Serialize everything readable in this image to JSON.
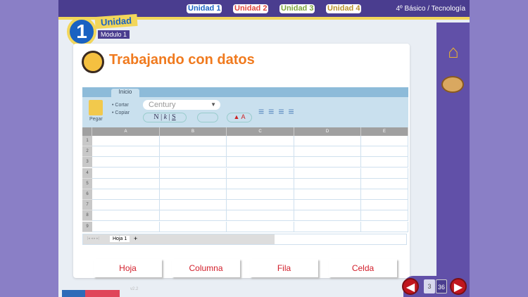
{
  "header": {
    "units": [
      {
        "label": "Unidad 1",
        "color": "#1a62c2"
      },
      {
        "label": "Unidad 2",
        "color": "#e0463c"
      },
      {
        "label": "Unidad 3",
        "color": "#7aa63a"
      },
      {
        "label": "Unidad 4",
        "color": "#b8902a"
      }
    ],
    "grade": "4º Básico / Tecnología"
  },
  "badge": {
    "number": "1",
    "unit": "Unidad",
    "module": "Módulo 1"
  },
  "title": "Trabajando con datos",
  "spreadsheet": {
    "tab": "Inicio",
    "paste": "Pegar",
    "cut": "Cortar",
    "copy": "Copiar",
    "font": "Century",
    "bold": "N",
    "italic": "k",
    "underline": "S",
    "columns": [
      "A",
      "B",
      "C",
      "D",
      "E"
    ],
    "rows": [
      "1",
      "2",
      "3",
      "4",
      "5",
      "6",
      "7",
      "8",
      "9"
    ],
    "sheet_tab": "Hoja 1",
    "add_sheet": "+"
  },
  "answers": [
    "Hoja",
    "Columna",
    "Fila",
    "Celda"
  ],
  "version": "v2.2",
  "pagination": {
    "current": "3",
    "total": "36"
  }
}
